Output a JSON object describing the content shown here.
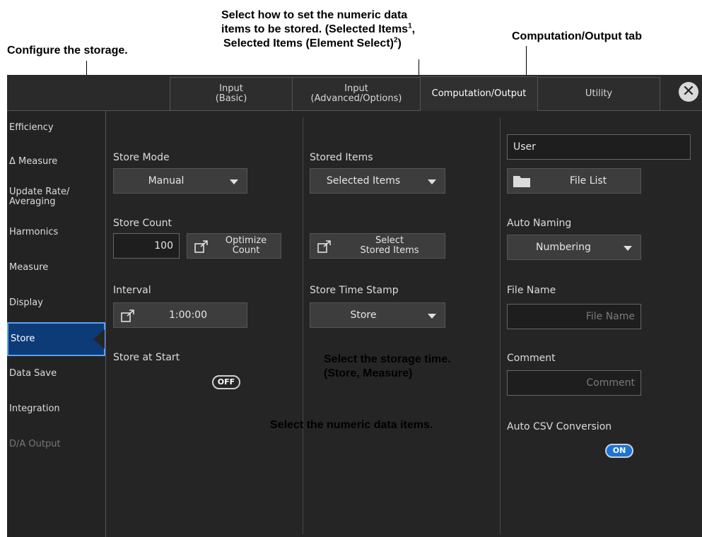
{
  "annotations": {
    "configure": "Configure the storage.",
    "select_how_1": "Select how to set the numeric data",
    "select_how_2a": "items to be stored. (Selected Items",
    "select_how_2sup": "1",
    "select_how_2b": ",",
    "select_how_3a": "Selected Items (Element Select)",
    "select_how_3sup": "2",
    "select_how_3b": ")",
    "tab_callout": "Computation/Output tab",
    "time_1": "Select the storage time.",
    "time_2": "(Store, Measure)",
    "items": "Select the numeric data items."
  },
  "tabs": [
    {
      "label": "Input\n(Basic)"
    },
    {
      "label": "Input\n(Advanced/Options)"
    },
    {
      "label": "Computation/Output"
    },
    {
      "label": "Utility"
    }
  ],
  "close_glyph": "✕",
  "sidebar": {
    "items": [
      {
        "label": "Efficiency"
      },
      {
        "label": "Δ Measure"
      },
      {
        "label": "Update Rate/\nAveraging"
      },
      {
        "label": "Harmonics"
      },
      {
        "label": "Measure"
      },
      {
        "label": "Display"
      },
      {
        "label": "Store"
      },
      {
        "label": "Data Save"
      },
      {
        "label": "Integration"
      },
      {
        "label": "D/A Output"
      }
    ]
  },
  "col1": {
    "store_mode_label": "Store Mode",
    "store_mode_value": "Manual",
    "store_count_label": "Store Count",
    "store_count_value": "100",
    "optimize_label": "Optimize\nCount",
    "interval_label": "Interval",
    "interval_value": "1:00:00",
    "store_at_start_label": "Store at Start",
    "store_at_start_toggle": "OFF"
  },
  "col2": {
    "stored_items_label": "Stored Items",
    "stored_items_value": "Selected Items",
    "select_stored_label": "Select\nStored Items",
    "timestamp_label": "Store Time Stamp",
    "timestamp_value": "Store"
  },
  "col3": {
    "user_value": "User",
    "file_list_label": "File List",
    "auto_naming_label": "Auto Naming",
    "auto_naming_value": "Numbering",
    "file_name_label": "File Name",
    "file_name_placeholder": "File Name",
    "comment_label": "Comment",
    "comment_placeholder": "Comment",
    "auto_csv_label": "Auto CSV Conversion",
    "auto_csv_toggle": "ON"
  },
  "colors": {
    "selected_bg": "#0c3b78",
    "toggle_on": "#1a73d9",
    "panel_bg": "#252525"
  }
}
